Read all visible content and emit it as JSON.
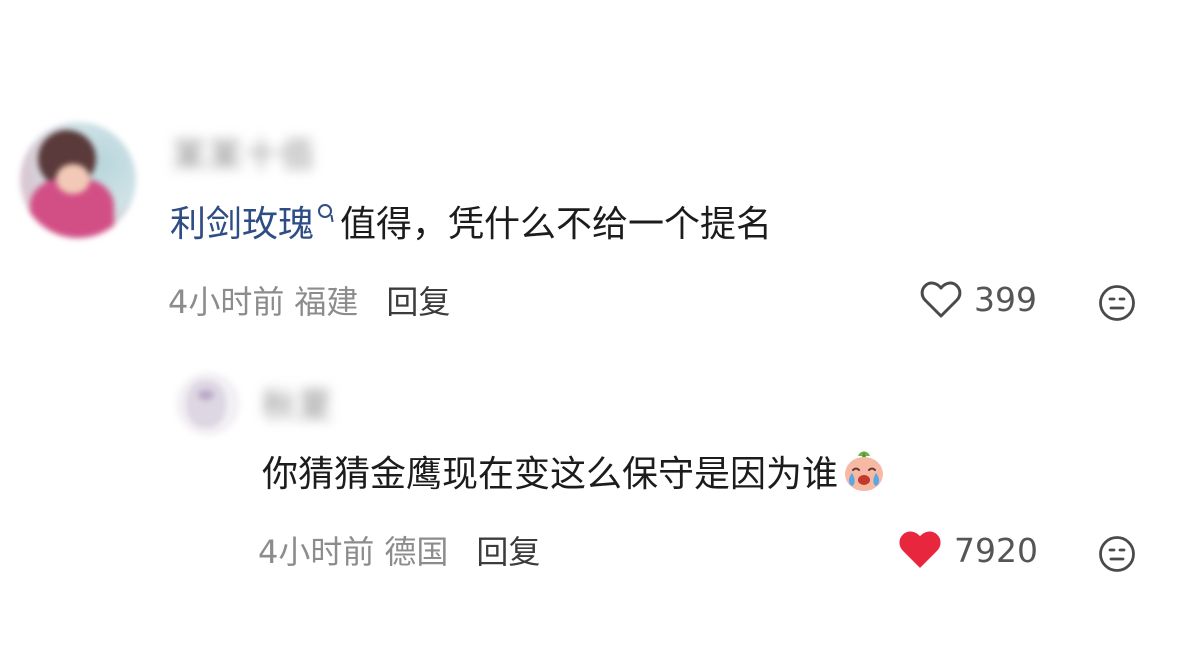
{
  "comment": {
    "username": "某某十佰",
    "mention": "利剑玫瑰",
    "text": "值得，凭什么不给一个提名",
    "time": "4小时前",
    "location": "福建",
    "reply_label": "回复",
    "likes": "399",
    "liked": false,
    "avatar_icon": "user-avatar"
  },
  "reply": {
    "username": "秋夏",
    "text": "你猜猜金鹰现在变这么保守是因为谁",
    "emoji": "crying-face-emoji",
    "time": "4小时前",
    "location": "德国",
    "reply_label": "回复",
    "likes": "7920",
    "liked": true,
    "avatar_icon": "user-avatar"
  },
  "colors": {
    "mention": "#2f4d85",
    "liked_heart": "#e8273f",
    "meta_text": "#8c8c8c",
    "body_text": "#1c1c1c"
  }
}
